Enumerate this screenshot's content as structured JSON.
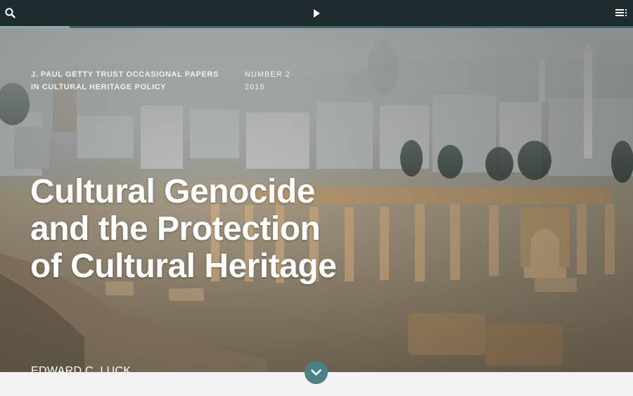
{
  "toolbar": {
    "search_icon": "search-icon",
    "play_icon": "play-icon",
    "menu_icon": "menu-icon",
    "reading_progress": 0.11
  },
  "header": {
    "series_line1": "J. PAUL GETTY TRUST OCCASIONAL PAPERS",
    "series_line2": "IN CULTURAL HERITAGE POLICY",
    "number_label": "NUMBER 2",
    "year": "2018"
  },
  "title": {
    "line1": "Cultural Genocide",
    "line2": "and the Protection",
    "line3": "of Cultural Heritage"
  },
  "author": "EDWARD C. LUCK",
  "scroll": {
    "icon": "chevron-down-icon"
  },
  "colors": {
    "topbar": "#1e2b2f",
    "accent": "#4d7f87"
  }
}
